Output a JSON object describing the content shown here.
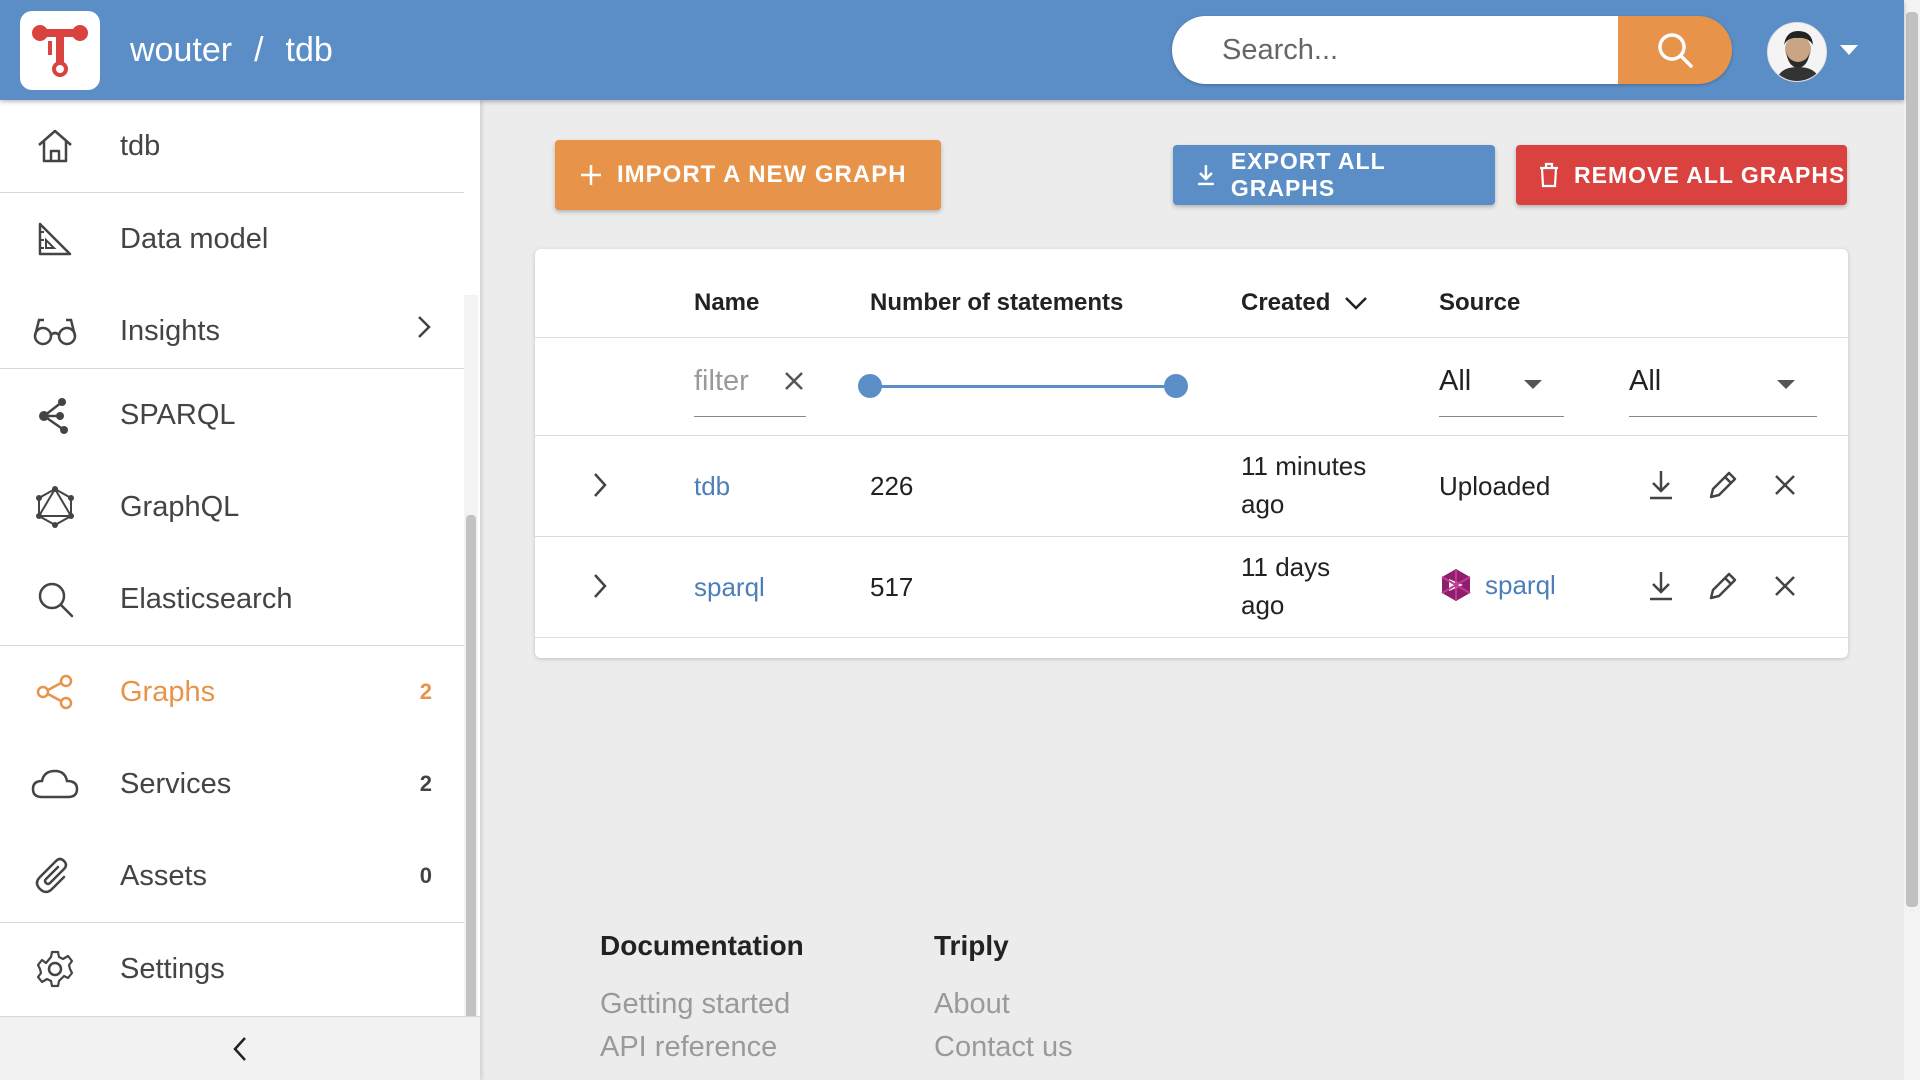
{
  "header": {
    "owner": "wouter",
    "separator": "/",
    "dataset": "tdb",
    "search_placeholder": "Search...",
    "icons": [
      "triply-logo-icon",
      "search-icon",
      "avatar",
      "caret-down-icon"
    ]
  },
  "sidebar": {
    "items": [
      {
        "label": "tdb",
        "icon": "home-icon"
      },
      {
        "label": "Data model",
        "icon": "ruler-icon"
      },
      {
        "label": "Insights",
        "icon": "glasses-icon"
      },
      {
        "label": "SPARQL",
        "icon": "sparql-icon"
      },
      {
        "label": "GraphQL",
        "icon": "graphql-icon"
      },
      {
        "label": "Elasticsearch",
        "icon": "search-icon"
      },
      {
        "label": "Graphs",
        "icon": "graphs-icon",
        "count": "2",
        "active": true
      },
      {
        "label": "Services",
        "icon": "cloud-icon",
        "count": "2"
      },
      {
        "label": "Assets",
        "icon": "paperclip-icon",
        "count": "0"
      },
      {
        "label": "Settings",
        "icon": "gear-icon"
      }
    ],
    "accent_color": "#e8934a"
  },
  "toolbar": {
    "import_label": "IMPORT A NEW GRAPH",
    "export_label": "EXPORT ALL GRAPHS",
    "remove_label": "REMOVE ALL GRAPHS"
  },
  "table": {
    "columns": [
      "Name",
      "Number of statements",
      "Created",
      "Source"
    ],
    "filter_placeholder": "filter",
    "created_select": "All",
    "source_select": "All",
    "rows": [
      {
        "name": "tdb",
        "statements": "226",
        "created_line1": "11 minutes",
        "created_line2": "ago",
        "source": "Uploaded"
      },
      {
        "name": "sparql",
        "statements": "517",
        "created_line1": "11 days",
        "created_line2": "ago",
        "source": "sparql",
        "source_icon": "sparql-logo-icon"
      }
    ]
  },
  "footer": {
    "documentation": {
      "title": "Documentation",
      "links": [
        "Getting started",
        "API reference"
      ]
    },
    "triply": {
      "title": "Triply",
      "links": [
        "About",
        "Contact us"
      ]
    }
  },
  "colors": {
    "header": "#5b8ec6",
    "accent": "#e8934a",
    "danger": "#d9423e",
    "link": "#4c7fb9"
  }
}
